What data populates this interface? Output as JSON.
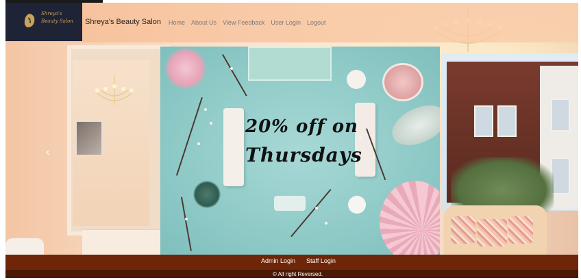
{
  "header": {
    "logo_script_line1": "Shreya's",
    "logo_script_line2": "Beauty Salon",
    "brand": "Shreya's Beauty Salon"
  },
  "nav": {
    "items": [
      "Home",
      "About Us",
      "View Feedback",
      "User Login",
      "Logout"
    ]
  },
  "carousel": {
    "promo_line1": "20% off on",
    "promo_line2": "Thursdays",
    "prev_icon": "chevron-left-icon"
  },
  "footer": {
    "links": [
      "Admin Login",
      "Staff Login"
    ],
    "copyright": "© All right Reversed."
  },
  "colors": {
    "footer_links_bg": "#6e2508",
    "footer_copy_bg": "#4a1a06",
    "logo_bg": "#1f2336",
    "promo_bg": "#8fcac7"
  }
}
